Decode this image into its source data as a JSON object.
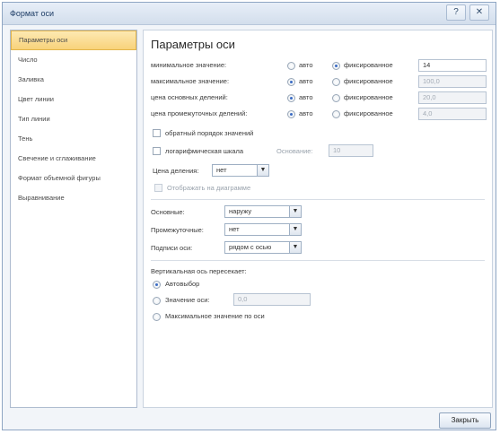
{
  "window": {
    "title": "Формат оси",
    "help_label": "?",
    "close_label": "✕"
  },
  "sidebar": {
    "items": [
      {
        "label": "Параметры оси",
        "active": true
      },
      {
        "label": "Число",
        "active": false
      },
      {
        "label": "Заливка",
        "active": false
      },
      {
        "label": "Цвет линии",
        "active": false
      },
      {
        "label": "Тип линии",
        "active": false
      },
      {
        "label": "Тень",
        "active": false
      },
      {
        "label": "Свечение и сглаживание",
        "active": false
      },
      {
        "label": "Формат объемной фигуры",
        "active": false
      },
      {
        "label": "Выравнивание",
        "active": false
      }
    ]
  },
  "panel": {
    "title": "Параметры оси",
    "auto_label": "авто",
    "fixed_label": "фиксированное",
    "rows": [
      {
        "label": "минимальное значение:",
        "mode": "fixed",
        "value": "14",
        "enabled": true
      },
      {
        "label": "максимальное значение:",
        "mode": "auto",
        "value": "100,0",
        "enabled": false
      },
      {
        "label": "цена основных делений:",
        "mode": "auto",
        "value": "20,0",
        "enabled": false
      },
      {
        "label": "цена промежуточных делений:",
        "mode": "auto",
        "value": "4,0",
        "enabled": false
      }
    ],
    "reverse_order_label": "обратный порядок значений",
    "log_scale_label": "логарифмическая шкала",
    "log_base_label": "Основание:",
    "log_base_value": "10",
    "display_units_label": "Цена деления:",
    "display_units_value": "нет",
    "show_units_label": "Отображать на диаграмме",
    "major_tick_label": "Основные:",
    "major_tick_value": "наружу",
    "minor_tick_label": "Промежуточные:",
    "minor_tick_value": "нет",
    "axis_labels_label": "Подписи оси:",
    "axis_labels_value": "рядом с осью",
    "crosses_title": "Вертикальная ось пересекает:",
    "crosses_auto": "Автовыбор",
    "crosses_value_label": "Значение оси:",
    "crosses_value": "0,0",
    "crosses_max": "Максимальное значение по оси"
  },
  "footer": {
    "close_button": "Закрыть"
  },
  "colors": {
    "accent": "#f8d27a",
    "radio_dot": "#3b6cc4",
    "border": "#8fa6c3"
  },
  "icons": {
    "dropdown": "chevron-down-icon"
  }
}
